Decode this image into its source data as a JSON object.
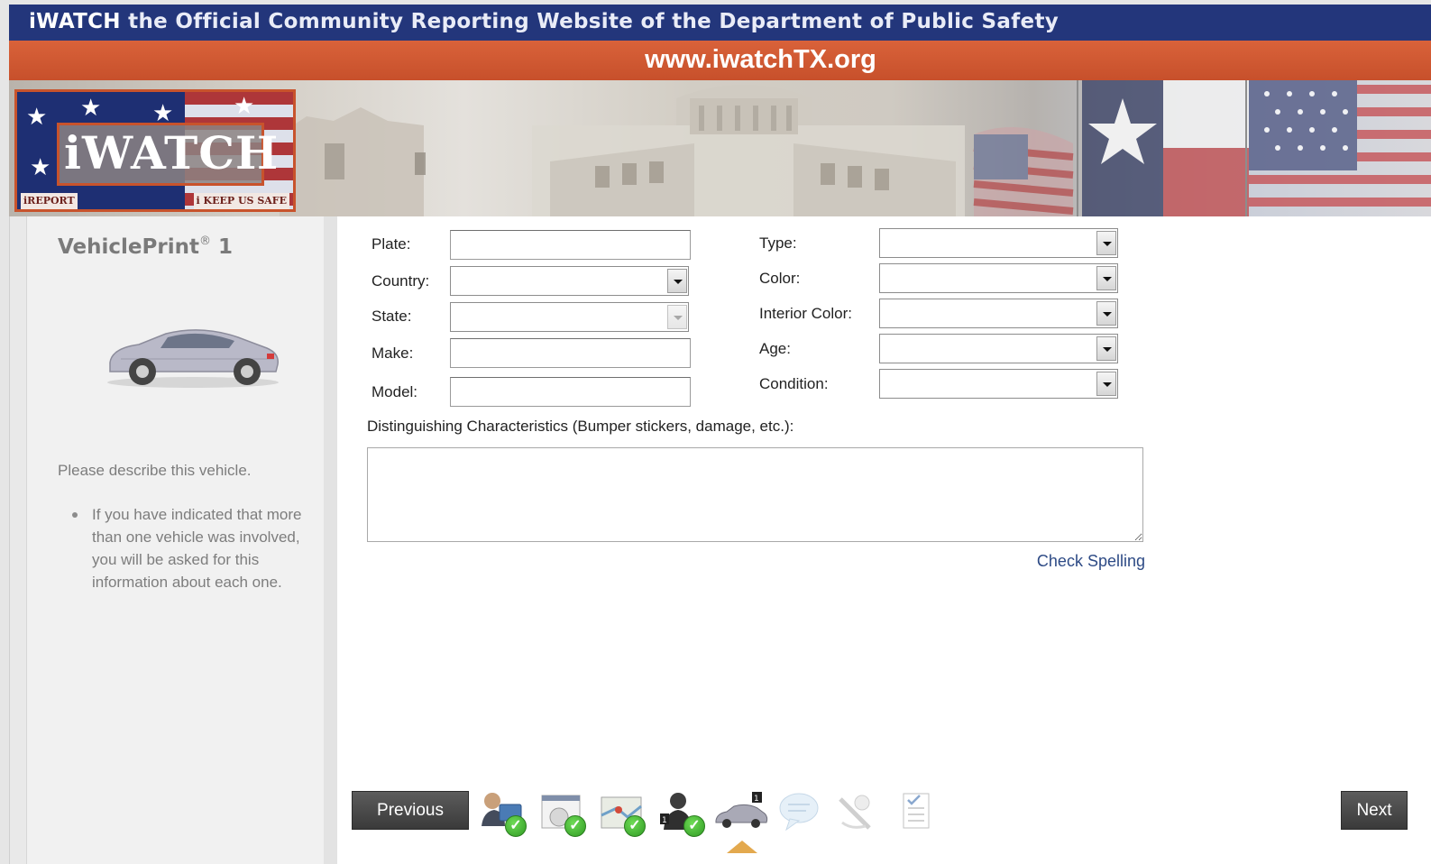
{
  "header": {
    "brand": "iWATCH",
    "tagline": " the Official Community Reporting Website of the Department of Public Safety",
    "url": "www.iwatchTX.org"
  },
  "logo": {
    "word": "iWATCH",
    "left_sub": "iREPORT",
    "right_sub": "i KEEP US SAFE"
  },
  "sidebar": {
    "title": "VehiclePrint",
    "title_mark": "®",
    "title_num": " 1",
    "description": "Please describe this vehicle.",
    "bullets": [
      "If you have indicated that more than one vehicle was involved, you will be asked for this information about each one."
    ]
  },
  "form": {
    "plate_label": "Plate:",
    "country_label": "Country:",
    "state_label": "State:",
    "make_label": "Make:",
    "model_label": "Model:",
    "type_label": "Type:",
    "color_label": "Color:",
    "interior_color_label": "Interior Color:",
    "age_label": "Age:",
    "condition_label": "Condition:",
    "plate_value": "",
    "make_value": "",
    "model_value": "",
    "country_value": "",
    "state_value": "",
    "type_value": "",
    "color_value": "",
    "interior_color_value": "",
    "age_value": "",
    "condition_value": "",
    "dc_label": "Distinguishing Characteristics (Bumper stickers, damage, etc.):",
    "dc_value": "",
    "check_spelling": "Check Spelling"
  },
  "nav": {
    "previous": "Previous",
    "next": "Next",
    "steps": [
      {
        "icon": "reporter-icon",
        "completed": true
      },
      {
        "icon": "event-icon",
        "completed": true
      },
      {
        "icon": "location-icon",
        "completed": true
      },
      {
        "icon": "person-icon",
        "completed": true
      },
      {
        "icon": "vehicle-icon",
        "completed": false,
        "current": true
      },
      {
        "icon": "comments-icon",
        "completed": false
      },
      {
        "icon": "attachments-icon",
        "completed": false
      },
      {
        "icon": "review-icon",
        "completed": false
      }
    ]
  },
  "colors": {
    "header_blue": "#23367b",
    "url_orange": "#d9623a",
    "link_blue": "#2d4a85",
    "button_dark": "#3a3a3a",
    "check_green": "#2f9a23",
    "step_marker": "#e3a94e"
  }
}
